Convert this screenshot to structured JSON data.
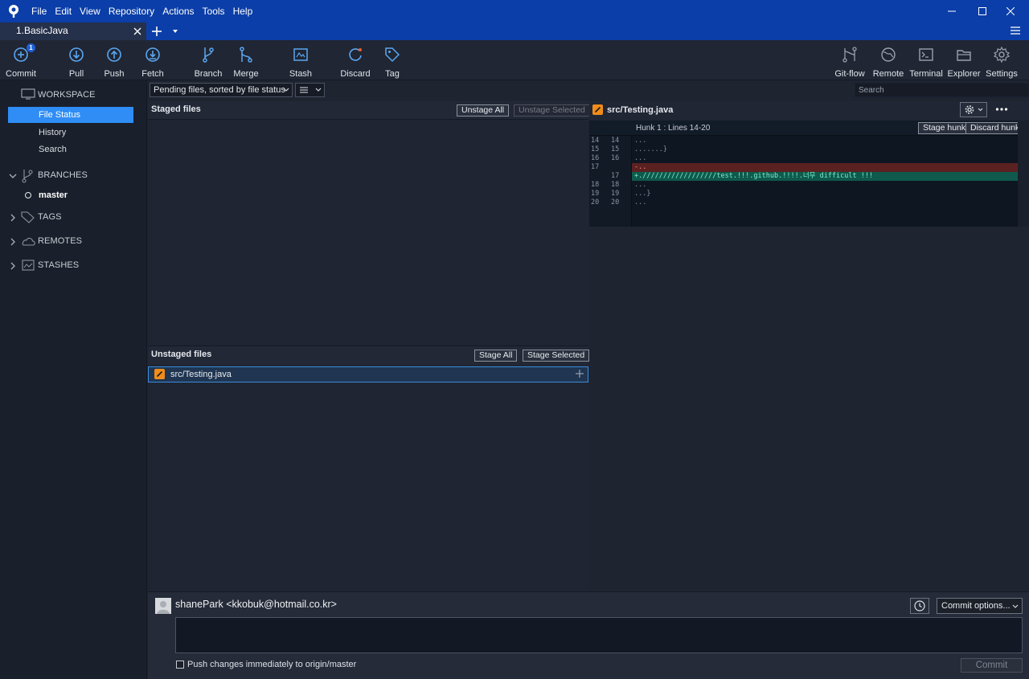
{
  "menu": {
    "items": [
      "File",
      "Edit",
      "View",
      "Repository",
      "Actions",
      "Tools",
      "Help"
    ]
  },
  "tabs": {
    "active": "1.BasicJava"
  },
  "toolbar": {
    "commit": "Commit",
    "commit_badge": "1",
    "pull": "Pull",
    "push": "Push",
    "fetch": "Fetch",
    "branch": "Branch",
    "merge": "Merge",
    "stash": "Stash",
    "discard": "Discard",
    "tag": "Tag",
    "gitflow": "Git-flow",
    "remote": "Remote",
    "terminal": "Terminal",
    "explorer": "Explorer",
    "settings": "Settings"
  },
  "sidebar": {
    "workspace": "WORKSPACE",
    "workspace_items": [
      "File Status",
      "History",
      "Search"
    ],
    "branches": "BRANCHES",
    "current_branch": "master",
    "tags": "TAGS",
    "remotes": "REMOTES",
    "stashes": "STASHES"
  },
  "filter": {
    "pending": "Pending files, sorted by file status"
  },
  "search": {
    "placeholder": "Search"
  },
  "staged": {
    "title": "Staged files",
    "unstage_all": "Unstage All",
    "unstage_selected": "Unstage Selected"
  },
  "unstaged": {
    "title": "Unstaged files",
    "stage_all": "Stage All",
    "stage_selected": "Stage Selected",
    "files": [
      "src/Testing.java"
    ]
  },
  "diff": {
    "file": "src/Testing.java",
    "hunk_label": "Hunk 1 : Lines 14-20",
    "stage_hunk": "Stage hunk",
    "discard_hunk": "Discard hunk",
    "lines": [
      {
        "old": "14",
        "new": "14",
        "text": "...",
        "kind": "ctx"
      },
      {
        "old": "15",
        "new": "15",
        "text": ".......}",
        "kind": "ctx"
      },
      {
        "old": "16",
        "new": "16",
        "text": "...",
        "kind": "ctx"
      },
      {
        "old": "17",
        "new": "",
        "text": "-..",
        "kind": "del"
      },
      {
        "old": "",
        "new": "17",
        "text": "+.//////////////////test.!!!.github.!!!!.너무 difficult !!!",
        "kind": "add"
      },
      {
        "old": "18",
        "new": "18",
        "text": "...",
        "kind": "ctx"
      },
      {
        "old": "19",
        "new": "19",
        "text": "...}",
        "kind": "ctx"
      },
      {
        "old": "20",
        "new": "20",
        "text": "...",
        "kind": "ctx"
      }
    ]
  },
  "commit": {
    "author": "shanePark <kkobuk@hotmail.co.kr>",
    "options": "Commit options...",
    "push_label": "Push changes immediately to origin/master",
    "button": "Commit"
  }
}
